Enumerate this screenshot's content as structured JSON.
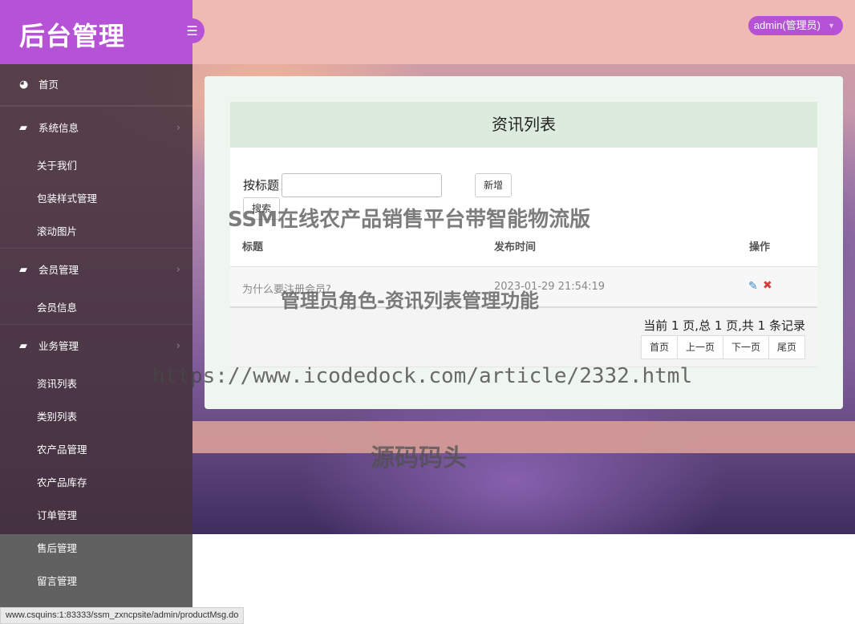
{
  "header": {
    "logo": "后台管理",
    "menu_toggle_icon": "hamburger-icon",
    "user": "admin(管理员)"
  },
  "sidebar": {
    "items": [
      {
        "label": "首页",
        "icon": "dashboard-icon",
        "type": "top"
      },
      {
        "label": "系统信息",
        "icon": "book-icon",
        "type": "group"
      },
      {
        "label": "关于我们",
        "type": "sub"
      },
      {
        "label": "包装样式管理",
        "type": "sub"
      },
      {
        "label": "滚动图片",
        "type": "sub"
      },
      {
        "label": "会员管理",
        "icon": "book-icon",
        "type": "group"
      },
      {
        "label": "会员信息",
        "type": "sub"
      },
      {
        "label": "业务管理",
        "icon": "book-icon",
        "type": "group"
      },
      {
        "label": "资讯列表",
        "type": "sub"
      },
      {
        "label": "类别列表",
        "type": "sub"
      },
      {
        "label": "农产品管理",
        "type": "sub"
      },
      {
        "label": "农产品库存",
        "type": "sub"
      },
      {
        "label": "订单管理",
        "type": "sub"
      },
      {
        "label": "售后管理",
        "type": "sub"
      },
      {
        "label": "留言管理",
        "type": "sub"
      }
    ]
  },
  "main": {
    "title": "资讯列表",
    "search": {
      "label": "按标题",
      "value": "",
      "placeholder": ""
    },
    "add_button": "新增",
    "search_button": "搜索",
    "columns": [
      "标题",
      "发布时间",
      "操作"
    ],
    "rows": [
      {
        "title": "为什么要注册会员?",
        "time": "2023-01-29 21:54:19"
      }
    ],
    "page_info": "当前 1 页,总 1 页,共 1 条记录",
    "pager": [
      "首页",
      "上一页",
      "下一页",
      "尾页"
    ]
  },
  "watermarks": [
    "SSM在线农产品销售平台带智能物流版",
    "管理员角色-资讯列表管理功能",
    "https://www.icodedock.com/article/2332.html",
    "源码码头"
  ],
  "status_bar": "www.csquins:1:83333/ssm_zxncpsite/admin/productMsg.do"
}
